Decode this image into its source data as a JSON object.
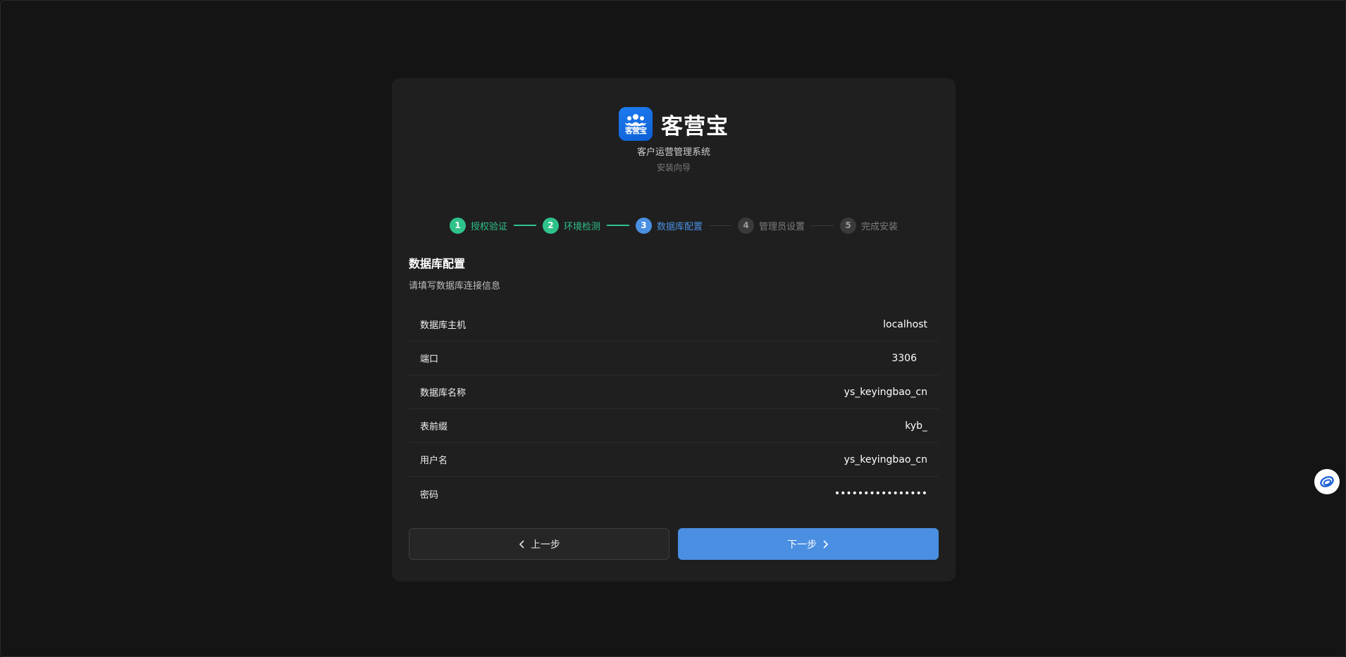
{
  "brand": {
    "name": "客营宝",
    "logo_text": "客营宝",
    "subtitle": "客户运营管理系统",
    "wizard_label": "安装向导"
  },
  "steps": [
    {
      "num": "1",
      "label": "授权验证",
      "status": "done"
    },
    {
      "num": "2",
      "label": "环境检测",
      "status": "done"
    },
    {
      "num": "3",
      "label": "数据库配置",
      "status": "active"
    },
    {
      "num": "4",
      "label": "管理员设置",
      "status": "todo"
    },
    {
      "num": "5",
      "label": "完成安装",
      "status": "todo"
    }
  ],
  "section": {
    "title": "数据库配置",
    "description": "请填写数据库连接信息"
  },
  "fields": {
    "host": {
      "label": "数据库主机",
      "value": "localhost"
    },
    "port": {
      "label": "端口",
      "value": "3306"
    },
    "db_name": {
      "label": "数据库名称",
      "value": "ys_keyingbao_cn"
    },
    "prefix": {
      "label": "表前缀",
      "value": "kyb_"
    },
    "username": {
      "label": "用户名",
      "value": "ys_keyingbao_cn"
    },
    "password": {
      "label": "密码",
      "value": "••••••••••••••••"
    }
  },
  "buttons": {
    "prev_label": "上一步",
    "next_label": "下一步"
  },
  "colors": {
    "background": "#141414",
    "card": "#1f1f1f",
    "done": "#2fc28a",
    "active": "#4a8fe2",
    "todo": "#3a3a3a"
  },
  "icons": {
    "logo": "people-group-icon",
    "prev": "chevron-left-icon",
    "next": "chevron-right-icon",
    "float": "assistant-ring-icon"
  }
}
